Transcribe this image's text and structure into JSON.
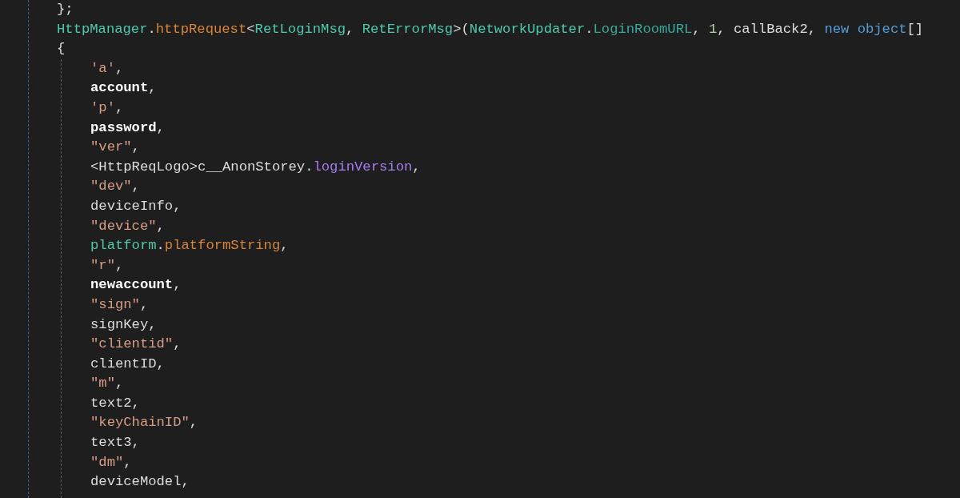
{
  "editor": {
    "lines": [
      {
        "tokens": [
          {
            "kind": "plain",
            "text": "};"
          }
        ]
      },
      {
        "tokens": [
          {
            "kind": "type",
            "text": "HttpManager"
          },
          {
            "kind": "plain",
            "text": "."
          },
          {
            "kind": "method",
            "text": "httpRequest"
          },
          {
            "kind": "plain",
            "text": "<"
          },
          {
            "kind": "type",
            "text": "RetLoginMsg"
          },
          {
            "kind": "plain",
            "text": ", "
          },
          {
            "kind": "type",
            "text": "RetErrorMsg"
          },
          {
            "kind": "plain",
            "text": ">("
          },
          {
            "kind": "type",
            "text": "NetworkUpdater"
          },
          {
            "kind": "plain",
            "text": "."
          },
          {
            "kind": "member",
            "text": "LoginRoomURL"
          },
          {
            "kind": "plain",
            "text": ", "
          },
          {
            "kind": "number",
            "text": "1"
          },
          {
            "kind": "plain",
            "text": ", callBack2, "
          },
          {
            "kind": "keyword",
            "text": "new object"
          },
          {
            "kind": "plain",
            "text": "[]"
          }
        ]
      },
      {
        "tokens": [
          {
            "kind": "plain",
            "text": "{"
          }
        ],
        "children": [
          {
            "tokens": [
              {
                "kind": "string",
                "text": "'a'"
              },
              {
                "kind": "plain",
                "text": ","
              }
            ]
          },
          {
            "tokens": [
              {
                "kind": "local",
                "text": "account"
              },
              {
                "kind": "plain",
                "text": ","
              }
            ]
          },
          {
            "tokens": [
              {
                "kind": "string",
                "text": "'p'"
              },
              {
                "kind": "plain",
                "text": ","
              }
            ]
          },
          {
            "tokens": [
              {
                "kind": "local",
                "text": "password"
              },
              {
                "kind": "plain",
                "text": ","
              }
            ]
          },
          {
            "tokens": [
              {
                "kind": "string",
                "text": "\"ver\""
              },
              {
                "kind": "plain",
                "text": ","
              }
            ]
          },
          {
            "tokens": [
              {
                "kind": "plain",
                "text": "<HttpReqLogo>c__AnonStorey."
              },
              {
                "kind": "field",
                "text": "loginVersion"
              },
              {
                "kind": "plain",
                "text": ","
              }
            ]
          },
          {
            "tokens": [
              {
                "kind": "string",
                "text": "\"dev\""
              },
              {
                "kind": "plain",
                "text": ","
              }
            ]
          },
          {
            "tokens": [
              {
                "kind": "plain",
                "text": "deviceInfo,"
              }
            ]
          },
          {
            "tokens": [
              {
                "kind": "string",
                "text": "\"device\""
              },
              {
                "kind": "plain",
                "text": ","
              }
            ]
          },
          {
            "tokens": [
              {
                "kind": "type",
                "text": "platform"
              },
              {
                "kind": "plain",
                "text": "."
              },
              {
                "kind": "method",
                "text": "platformString"
              },
              {
                "kind": "plain",
                "text": ","
              }
            ]
          },
          {
            "tokens": [
              {
                "kind": "string",
                "text": "\"r\""
              },
              {
                "kind": "plain",
                "text": ","
              }
            ]
          },
          {
            "tokens": [
              {
                "kind": "local",
                "text": "newaccount"
              },
              {
                "kind": "plain",
                "text": ","
              }
            ]
          },
          {
            "tokens": [
              {
                "kind": "string",
                "text": "\"sign\""
              },
              {
                "kind": "plain",
                "text": ","
              }
            ]
          },
          {
            "tokens": [
              {
                "kind": "plain",
                "text": "signKey,"
              }
            ]
          },
          {
            "tokens": [
              {
                "kind": "string",
                "text": "\"clientid\""
              },
              {
                "kind": "plain",
                "text": ","
              }
            ]
          },
          {
            "tokens": [
              {
                "kind": "plain",
                "text": "clientID,"
              }
            ]
          },
          {
            "tokens": [
              {
                "kind": "string",
                "text": "\"m\""
              },
              {
                "kind": "plain",
                "text": ","
              }
            ]
          },
          {
            "tokens": [
              {
                "kind": "plain",
                "text": "text2,"
              }
            ]
          },
          {
            "tokens": [
              {
                "kind": "string",
                "text": "\"keyChainID\""
              },
              {
                "kind": "plain",
                "text": ","
              }
            ]
          },
          {
            "tokens": [
              {
                "kind": "plain",
                "text": "text3,"
              }
            ]
          },
          {
            "tokens": [
              {
                "kind": "string",
                "text": "\"dm\""
              },
              {
                "kind": "plain",
                "text": ","
              }
            ]
          },
          {
            "tokens": [
              {
                "kind": "plain",
                "text": "deviceModel,"
              }
            ]
          }
        ]
      }
    ]
  }
}
